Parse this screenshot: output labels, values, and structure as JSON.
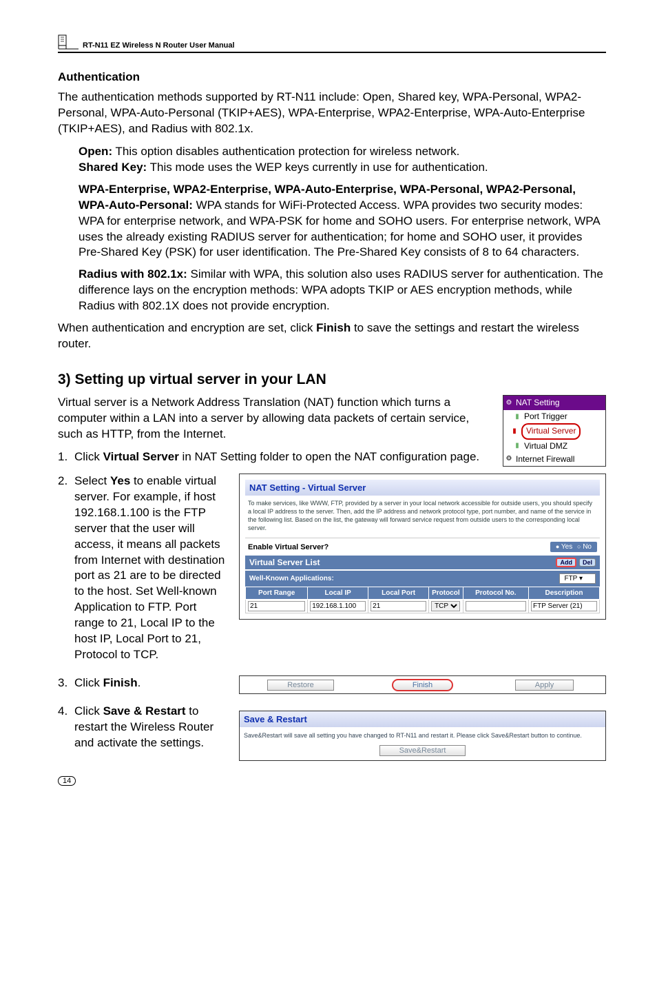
{
  "header": {
    "manual_title": "RT-N11 EZ Wireless N Router User Manual"
  },
  "auth": {
    "heading": "Authentication",
    "intro": "The authentication methods supported by RT-N11 include: Open, Shared key, WPA-Personal, WPA2-Personal, WPA-Auto-Personal (TKIP+AES), WPA-Enterprise, WPA2-Enterprise, WPA-Auto-Enterprise (TKIP+AES), and Radius with 802.1x.",
    "open_b": "Open:",
    "open_t": " This option disables authentication protection for wireless network.",
    "sk_b": "Shared Key:",
    "sk_t": " This mode uses the WEP keys currently in use for authentication.",
    "wpa_b": "WPA-Enterprise, WPA2-Enterprise, WPA-Auto-Enterprise, WPA-Personal, WPA2-Personal, WPA-Auto-Personal:",
    "wpa_t": " WPA stands for WiFi-Protected Access. WPA provides two security modes: WPA for enterprise network, and WPA-PSK for home and SOHO users. For enterprise network, WPA uses the already existing RADIUS server for authentication; for home and SOHO user, it provides Pre-Shared Key (PSK) for user identification. The Pre-Shared Key consists of 8 to 64 characters.",
    "rad_b": "Radius with 802.1x:",
    "rad_t": " Similar with WPA, this solution also uses RADIUS server for authentication. The difference lays on the encryption methods: WPA adopts TKIP or AES encryption methods, while Radius with 802.1X does not provide encryption.",
    "outro_p1": "When authentication and encryption are set, click ",
    "outro_b": "Finish",
    "outro_p2": " to save the settings and restart the wireless router."
  },
  "vs": {
    "heading": "3) Setting up virtual server in your LAN",
    "intro": "Virtual server is a Network Address Translation (NAT) function which turns a computer within a LAN into a server by allowing data packets of certain service, such as HTTP, from the Internet.",
    "step1_n": "1.",
    "step1_a": "Click ",
    "step1_b": "Virtual Server",
    "step1_c": " in NAT Setting folder to open the NAT configuration page.",
    "step2_n": "2.",
    "step2_a": "Select ",
    "step2_b": "Yes",
    "step2_c": " to enable virtual server. For example, if host 192.168.1.100 is the FTP server that the user will access, it means all packets from Internet with destination port as 21 are to be directed to the host. Set Well-known Application to FTP. Port range to 21, Local IP to the host IP, Local Port to 21, Protocol to TCP.",
    "step3_n": "3.",
    "step3_a": "Click ",
    "step3_b": "Finish",
    "step3_c": ".",
    "step4_n": "4.",
    "step4_a": "Click ",
    "step4_b": "Save & Restart",
    "step4_c": " to restart the Wireless Router and activate the settings."
  },
  "natmenu": {
    "title": "NAT Setting",
    "pt": "Port Trigger",
    "vsrv": "Virtual Server",
    "vdmz": "Virtual DMZ",
    "if": "Internet Firewall"
  },
  "vsshot": {
    "title": "NAT Setting - Virtual Server",
    "desc": "To make services, like WWW, FTP, provided by a server in your local network accessible for outside users, you should specify a local IP address to the server. Then, add the IP address and network protocol type, port number, and name of the service in the following list. Based on the list, the gateway will forward service request from outside users to the corresponding local server.",
    "enable_lbl": "Enable Virtual Server?",
    "yes": "Yes",
    "no": "No",
    "list_title": "Virtual Server List",
    "add": "Add",
    "del": "Del",
    "wk_lbl": "Well-Known Applications:",
    "wk_val": "FTP",
    "th_pr": "Port Range",
    "th_lip": "Local IP",
    "th_lp": "Local Port",
    "th_proto": "Protocol",
    "th_pno": "Protocol No.",
    "th_desc": "Description",
    "r_pr": "21",
    "r_lip": "192.168.1.100",
    "r_lp": "21",
    "r_proto": "TCP",
    "r_pno": "",
    "r_desc": "FTP Server (21)"
  },
  "btnbar": {
    "restore": "Restore",
    "finish": "Finish",
    "apply": "Apply"
  },
  "sr": {
    "title": "Save & Restart",
    "desc": "Save&Restart will save all setting you have changed to RT-N11 and restart it. Please click Save&Restart button to continue.",
    "btn": "Save&Restart"
  },
  "pagenum": "14"
}
